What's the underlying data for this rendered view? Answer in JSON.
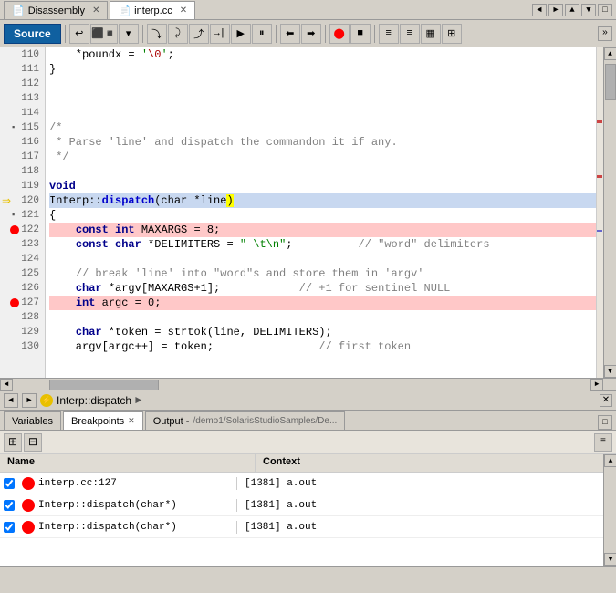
{
  "titlebar": {
    "tabs": [
      {
        "label": "Disassembly",
        "icon": "📄",
        "active": false,
        "closable": true
      },
      {
        "label": "interp.cc",
        "icon": "📄",
        "active": true,
        "closable": true
      }
    ],
    "controls": [
      "◄",
      "►",
      "▲",
      "▼",
      "□"
    ]
  },
  "toolbar": {
    "source_label": "Source",
    "buttons": [
      "↩",
      "⬛",
      "⬜",
      "▾",
      "⇦",
      "⇨",
      "⇧",
      "↯",
      "⇩",
      "⇪",
      "⏩",
      "⏪",
      "⏫",
      "⏬",
      "⏭",
      "⬤",
      "⬛",
      "≡",
      "≡",
      "⊞",
      "⊟"
    ]
  },
  "code": {
    "lines": [
      {
        "num": 110,
        "content": "    *poundx = '\\0';",
        "type": "normal",
        "indent": 4
      },
      {
        "num": 111,
        "content": "}",
        "type": "normal",
        "indent": 0
      },
      {
        "num": 112,
        "content": "",
        "type": "normal"
      },
      {
        "num": 113,
        "content": "",
        "type": "normal"
      },
      {
        "num": 114,
        "content": "",
        "type": "normal"
      },
      {
        "num": 115,
        "content": "/*",
        "type": "comment",
        "expand": true
      },
      {
        "num": 116,
        "content": " * Parse 'line' and dispatch the commandon it if any.",
        "type": "comment"
      },
      {
        "num": 117,
        "content": " */",
        "type": "comment"
      },
      {
        "num": 118,
        "content": "",
        "type": "normal"
      },
      {
        "num": 119,
        "content": "void",
        "type": "keyword"
      },
      {
        "num": 120,
        "content": "Interp::dispatch(char *line)",
        "type": "function",
        "highlight": true,
        "arrow": true
      },
      {
        "num": 121,
        "content": "{",
        "type": "normal",
        "expand": true
      },
      {
        "num": 122,
        "content": "    const int MAXARGS = 8;",
        "type": "breakpoint"
      },
      {
        "num": 123,
        "content": "    const char *DELIMITERS = \" \\t\\n\";        // \"word\" delimiters",
        "type": "normal"
      },
      {
        "num": 124,
        "content": "",
        "type": "normal"
      },
      {
        "num": 125,
        "content": "    // break 'line' into \"word\"s and store them in 'argv'",
        "type": "comment"
      },
      {
        "num": 126,
        "content": "    char *argv[MAXARGS+1];            // +1 for sentinel NULL",
        "type": "normal"
      },
      {
        "num": 127,
        "content": "    int argc = 0;",
        "type": "breakpoint"
      },
      {
        "num": 128,
        "content": "",
        "type": "normal"
      },
      {
        "num": 129,
        "content": "    char *token = strtok(line, DELIMITERS);",
        "type": "normal"
      },
      {
        "num": 130,
        "content": "    argv[argc++] = token;                // first token",
        "type": "normal"
      }
    ]
  },
  "breadcrumb": {
    "back_label": "◄",
    "forward_label": "►",
    "icon": "⚡",
    "text": "Interp::dispatch",
    "arrow": "►"
  },
  "bottom_panel": {
    "tabs": [
      {
        "label": "Variables",
        "active": false,
        "closable": false
      },
      {
        "label": "Breakpoints",
        "active": true,
        "closable": true
      },
      {
        "label": "Output -",
        "active": false,
        "closable": false
      }
    ],
    "path": "/demo1/SolarisStudioSamples/De...",
    "columns": [
      "Name",
      "Context"
    ],
    "rows": [
      {
        "checked": true,
        "name": "interp.cc:127",
        "context": "[1381] a.out",
        "bp": true
      },
      {
        "checked": true,
        "name": "Interp::dispatch(char*)",
        "context": "[1381] a.out",
        "bp": true
      },
      {
        "checked": true,
        "name": "Interp::dispatch(char*)",
        "context": "[1381] a.out",
        "bp": true
      }
    ]
  }
}
